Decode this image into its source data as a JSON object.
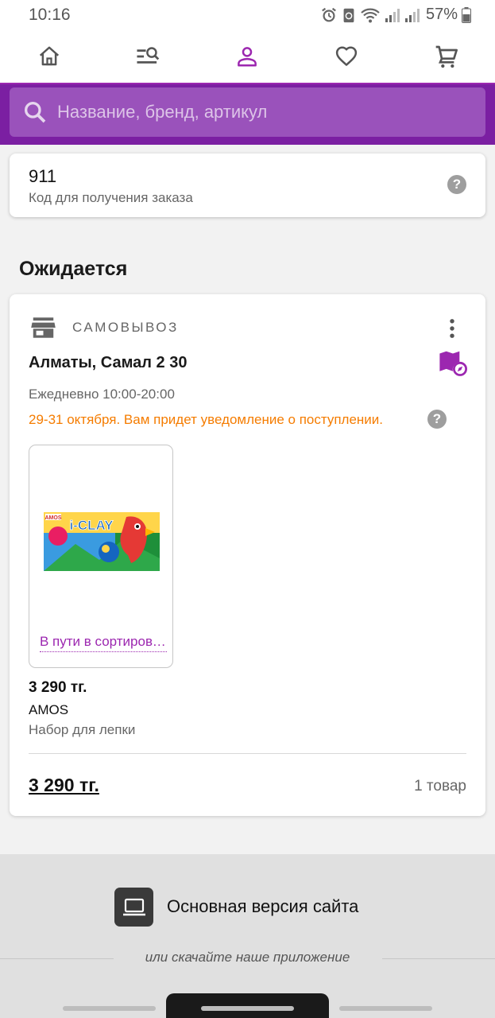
{
  "status_bar": {
    "time": "10:16",
    "battery": "57%"
  },
  "nav": {
    "items": [
      "home-icon",
      "catalog-search-icon",
      "profile-icon",
      "favorites-icon",
      "cart-icon"
    ],
    "active_color": "#9c27b0"
  },
  "search": {
    "placeholder": "Название, бренд, артикул"
  },
  "pickup_code": {
    "value": "911",
    "label": "Код для получения заказа"
  },
  "section": {
    "title": "Ожидается"
  },
  "order": {
    "delivery_type": "САМОВЫВОЗ",
    "address": "Алматы, Самал 2 30",
    "hours": "Ежедневно 10:00-20:00",
    "notice": "29-31 октября. Вам придет уведомление о поступлении.",
    "item": {
      "status": "В пути в сортировочный центр",
      "price": "3 290 тг.",
      "brand": "AMOS",
      "name": "Набор для лепки",
      "image_brand": "AMOS",
      "image_title": "i-CLAY"
    },
    "total": "3 290 тг.",
    "count": "1 товар"
  },
  "footer": {
    "desktop_label": "Основная версия сайта",
    "app_prompt": "или скачайте наше приложение"
  },
  "colors": {
    "brand": "#7b1fa2",
    "accent": "#9c27b0",
    "notice": "#f57c00"
  }
}
